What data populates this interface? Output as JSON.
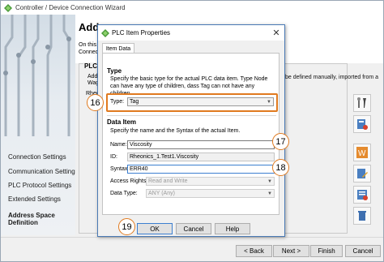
{
  "wizard": {
    "title": "Controller / Device Connection Wizard",
    "heading": "Addre",
    "intro_line1": "On this",
    "intro_line2": "Connec",
    "group_label": "PLC I",
    "group_text_add": "Add",
    "group_text_wag": "Wag",
    "list_cell": "Rhec",
    "bg_right_text": "be defined manually, imported from a",
    "nav": [
      {
        "label": "Connection Settings",
        "bold": false
      },
      {
        "label": "Communication Settings",
        "bold": false
      },
      {
        "label": "PLC Protocol Settings",
        "bold": false
      },
      {
        "label": "Extended Settings",
        "bold": false
      },
      {
        "label": "Address Space",
        "bold": true
      },
      {
        "label": "Definition",
        "bold": true
      }
    ],
    "buttons": {
      "back": "< Back",
      "next": "Next >",
      "finish": "Finish",
      "cancel": "Cancel"
    },
    "right_icons": [
      "tools-icon",
      "import-icon",
      "export-icon",
      "word-icon",
      "edit-icon",
      "list-icon",
      "delete-icon"
    ]
  },
  "dialog": {
    "title": "PLC Item Properties",
    "close_glyph": "✕",
    "tab": "Item Data",
    "type_section": "Type",
    "type_desc": "Specify the basic type for the actual PLC data item. Type Node can have any type of children, dass Tag can not have any children.",
    "type_label": "Type:",
    "type_value": "Tag",
    "data_section": "Data Item",
    "data_desc": "Specify the name and the Syntax of the actual Item.",
    "name_label": "Name:",
    "name_value": "Viscosity",
    "id_label": "ID:",
    "id_value": "Rheonics_1.Test1.Viscosity",
    "syntax_label": "Syntax:",
    "syntax_value": "ERR40",
    "access_label": "Access Rights:",
    "access_value": "Read and Write",
    "datatype_label": "Data Type:",
    "datatype_value": "ANY (Any)",
    "buttons": {
      "ok": "OK",
      "cancel": "Cancel",
      "help": "Help"
    }
  },
  "callouts": [
    "16",
    "17",
    "18",
    "19"
  ],
  "colors": {
    "accent": "#e07a1f",
    "focus": "#3c7fd0",
    "dialog_border": "#4a7ab5"
  }
}
